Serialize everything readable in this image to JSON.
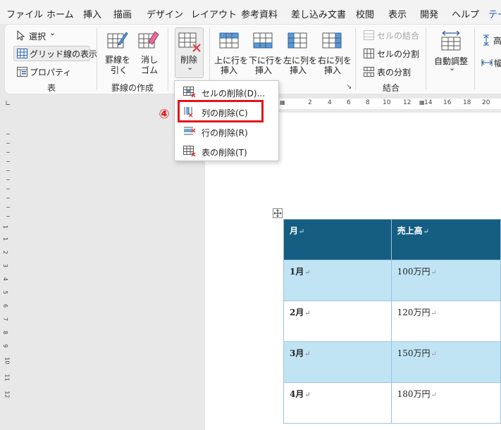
{
  "menu": {
    "items": [
      "ファイル",
      "ホーム",
      "挿入",
      "描画",
      "デザイン",
      "レイアウト",
      "参考資料",
      "差し込み文書",
      "校閲",
      "表示",
      "開発",
      "ヘルプ",
      "テー"
    ],
    "active_index": 12
  },
  "ribbon": {
    "select_label": "選択",
    "select_chevron": "⌄",
    "gridlines_label": "グリッド線の表示",
    "properties_label": "プロパティ",
    "group_table": "表",
    "draw_line_label": [
      "罫線を",
      "引く"
    ],
    "eraser_label": [
      "消し",
      "ゴム"
    ],
    "group_borders": "罫線の作成",
    "delete_label": "削除",
    "delete_chevron": "⌄",
    "insert_above_label": [
      "上に行を",
      "挿入"
    ],
    "insert_below_label": [
      "下に行を",
      "挿入"
    ],
    "insert_left_label": [
      "左に列を",
      "挿入"
    ],
    "insert_right_label": [
      "右に列を",
      "挿入"
    ],
    "merge_cells_label": "セルの結合",
    "split_cells_label": "セルの分割",
    "split_table_label": "表の分割",
    "group_merge": "結合",
    "autofit_label": "自動調整",
    "autofit_chevron": "⌄",
    "height_label": "高",
    "width_label": "幅",
    "dialog_launcher": "↘"
  },
  "ruler": {
    "numbers": [
      "2",
      "4",
      "6",
      "8",
      "10",
      "12",
      "14",
      "16",
      "18",
      "20"
    ],
    "vertical_numbers": [
      "1",
      "1",
      "2",
      "3",
      "4",
      "5",
      "6",
      "7",
      "8",
      "9",
      "10",
      "11",
      "12"
    ]
  },
  "dropdown": {
    "items": [
      {
        "label": "セルの削除(D)...",
        "icon": "delete-cells-icon"
      },
      {
        "label": "列の削除(C)",
        "icon": "delete-columns-icon"
      },
      {
        "label": "行の削除(R)",
        "icon": "delete-rows-icon"
      },
      {
        "label": "表の削除(T)",
        "icon": "delete-table-icon"
      }
    ],
    "highlighted_index": 1
  },
  "step_marker": "④",
  "table": {
    "headers": [
      "月",
      "売上高"
    ],
    "rows": [
      [
        "1月",
        "100万円"
      ],
      [
        "2月",
        "120万円"
      ],
      [
        "3月",
        "150万円"
      ],
      [
        "4月",
        "180万円"
      ]
    ],
    "cell_end_mark": "↵"
  },
  "colors": {
    "accent": "#185abd",
    "table_header": "#155d81",
    "table_band": "#c1e4f5",
    "highlight_box": "#e3141b"
  }
}
